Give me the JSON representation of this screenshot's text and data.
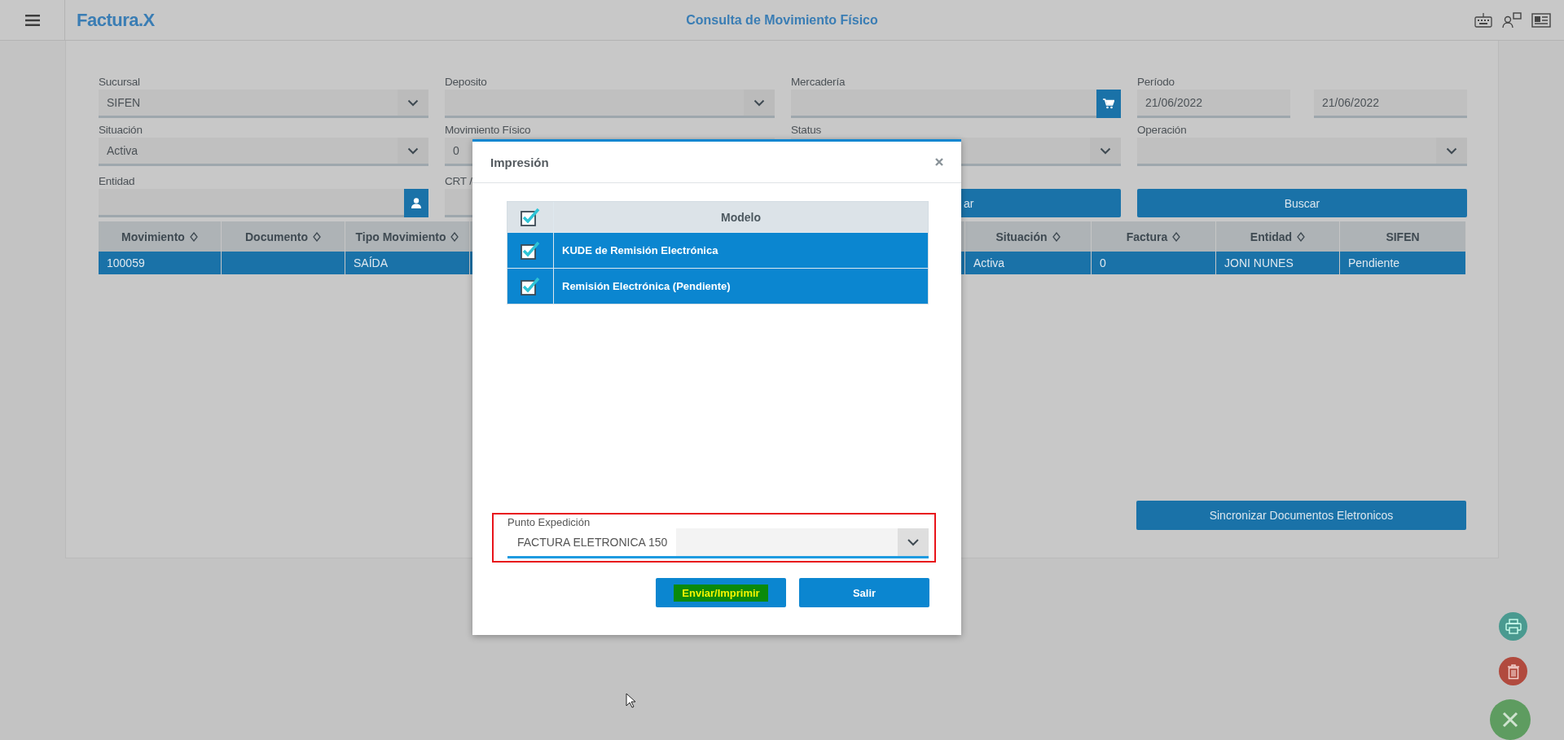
{
  "header": {
    "logo": "Factura.X",
    "title": "Consulta de Movimiento Físico"
  },
  "form": {
    "rows": [
      [
        {
          "kind": "select",
          "label": "Sucursal",
          "value": "SIFEN"
        },
        {
          "kind": "select",
          "label": "Deposito"
        },
        {
          "kind": "product_lookup",
          "label": "Mercadería"
        },
        {
          "kind": "daterange",
          "label": "Período",
          "values": [
            "21/06/2022",
            "21/06/2022"
          ]
        }
      ],
      [
        {
          "kind": "select",
          "label": "Situación",
          "value": "Activa"
        },
        {
          "kind": "text",
          "label": "Movimiento Físico",
          "value": "0"
        },
        {
          "kind": "select",
          "label": "Status"
        },
        {
          "kind": "select",
          "label": "Operación"
        }
      ],
      [
        {
          "kind": "entity_lookup",
          "label": "Entidad"
        },
        {
          "kind": "text",
          "label": "CRT /"
        },
        {
          "kind": "button",
          "label": "ar"
        },
        {
          "kind": "button",
          "label": "Buscar"
        }
      ]
    ]
  },
  "table": {
    "columns": [
      {
        "label": "Movimiento",
        "sortable": true
      },
      {
        "label": "Documento",
        "sortable": true
      },
      {
        "label": "Tipo Movimiento",
        "sortable": true
      },
      {
        "label": "Situación",
        "sortable": true
      },
      {
        "label": "Factura",
        "sortable": true
      },
      {
        "label": "Entidad",
        "sortable": true
      },
      {
        "label": "SIFEN",
        "sortable": false
      }
    ],
    "rows": [
      {
        "selected": true,
        "cells": [
          "100059",
          "",
          "SAÍDA",
          "Activa",
          "0",
          "JONI NUNES",
          "Pendiente"
        ]
      }
    ]
  },
  "sync_button": "Sincronizar Documentos Eletronicos",
  "dialog": {
    "title": "Impresión",
    "column": "Modelo",
    "all_checked": true,
    "models": [
      {
        "label": "KUDE de Remisión Electrónica",
        "checked": true,
        "selected": true
      },
      {
        "label": "Remisión Electrónica (Pendiente)",
        "checked": true,
        "selected": true
      }
    ],
    "field": {
      "label": "Punto Expedición",
      "value": "FACTURA ELETRONICA 150",
      "highlighted": true
    },
    "buttons": [
      {
        "label": "Enviar/Imprimir",
        "highlighted": true
      },
      {
        "label": "Salir",
        "highlighted": false
      }
    ]
  }
}
